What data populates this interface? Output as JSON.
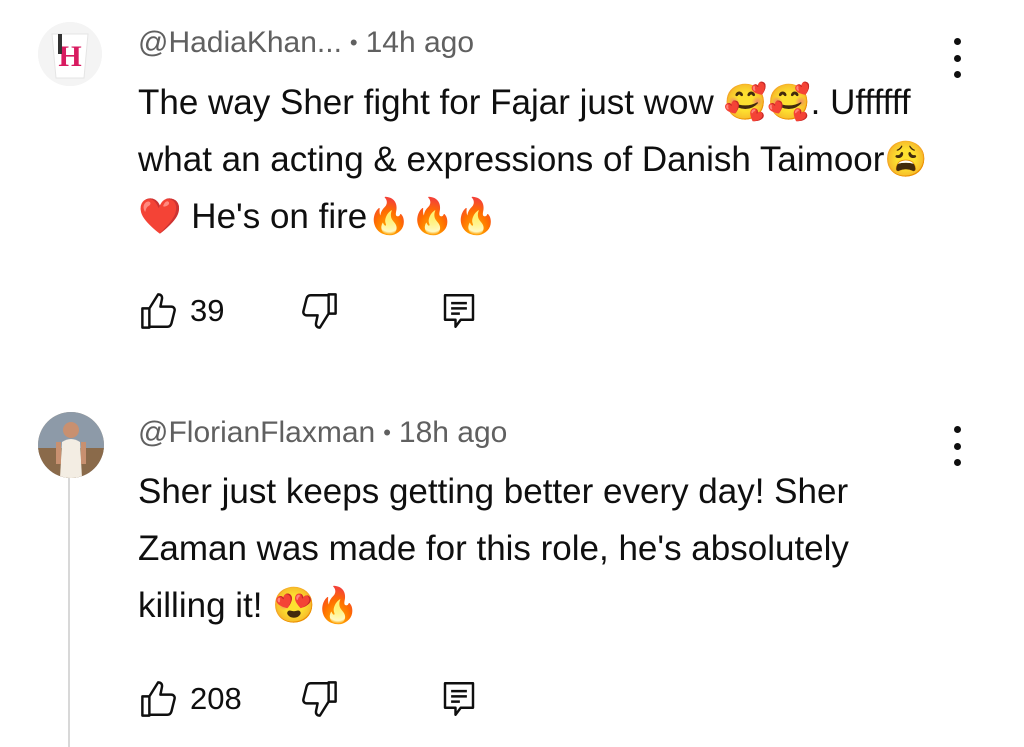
{
  "comments": [
    {
      "author": "@HadiaKhan...",
      "time": "14h ago",
      "text": "The way Sher fight for Fajar just wow 🥰🥰. Uffffff what an acting & expressions of Danish Taimoor😩❤️ He's on fire🔥🔥🔥",
      "likes": "39",
      "avatar_letter": "H",
      "icons": {
        "like": "thumbs-up-icon",
        "dislike": "thumbs-down-icon",
        "reply": "reply-icon",
        "more": "more-vert-icon"
      }
    },
    {
      "author": "@FlorianFlaxman",
      "time": "18h ago",
      "text": "Sher just keeps getting better every day! Sher Zaman was made for this role, he's absolutely killing it! 😍🔥",
      "likes": "208",
      "icons": {
        "like": "thumbs-up-icon",
        "dislike": "thumbs-down-icon",
        "reply": "reply-icon",
        "more": "more-vert-icon"
      }
    }
  ],
  "colors": {
    "text": "#0f0f0f",
    "meta": "#606060",
    "avatar1_accent": "#d81b60"
  }
}
